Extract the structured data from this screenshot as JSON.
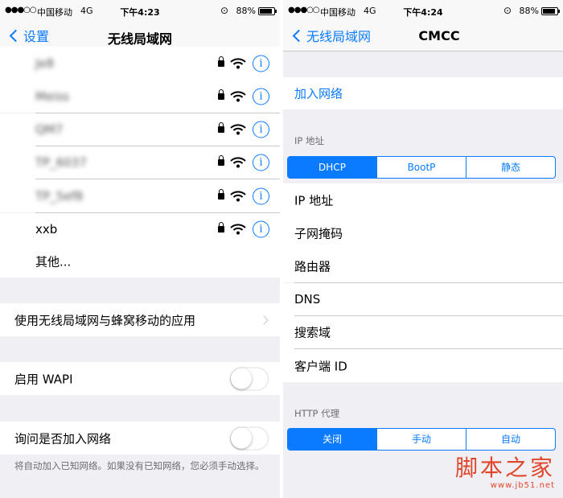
{
  "left": {
    "status": {
      "signal": "●●●○○",
      "carrier": "中国移动",
      "network": "4G",
      "time": "下午4:23",
      "battery_pct": "88%",
      "battery_level": 0.88
    },
    "nav": {
      "back_label": "设置",
      "title": "无线局域网"
    },
    "networks": [
      {
        "name": "Je8",
        "blurred": true
      },
      {
        "name": "Meiss",
        "blurred": true
      },
      {
        "name": "QM7",
        "blurred": true
      },
      {
        "name": "TP_6037",
        "blurred": true
      },
      {
        "name": "TP_5ef8",
        "blurred": true
      },
      {
        "name": "xxb",
        "blurred": false
      }
    ],
    "other_label": "其他...",
    "apps_label": "使用无线局域网与蜂窝移动的应用",
    "wapi_label": "启用 WAPI",
    "ask_join_label": "询问是否加入网络",
    "footer": "将自动加入已知网络。如果没有已知网络，您必须手动选择。"
  },
  "right": {
    "status": {
      "signal": "●●●○○",
      "carrier": "中国移动",
      "network": "4G",
      "time": "下午4:24",
      "battery_pct": "88%",
      "battery_level": 0.88
    },
    "nav": {
      "back_label": "无线局域网",
      "title": "CMCC"
    },
    "join_label": "加入网络",
    "ip_header": "IP 地址",
    "ip_segments": [
      "DHCP",
      "BootP",
      "静态"
    ],
    "ip_selected": 0,
    "rows": [
      "IP 地址",
      "子网掩码",
      "路由器",
      "DNS",
      "搜索域",
      "客户端 ID"
    ],
    "proxy_header": "HTTP 代理",
    "proxy_segments": [
      "关闭",
      "手动",
      "自动"
    ],
    "proxy_selected": 0
  },
  "watermark": {
    "title": "脚本之家",
    "url": "www.jb51.net"
  },
  "colors": {
    "accent": "#0a7aff",
    "background": "#efeff4",
    "separator": "#c8c7cc",
    "watermark": "#e0462a"
  },
  "icons": {
    "lock": "lock-icon",
    "wifi": "wifi-icon",
    "info": "info-icon",
    "back": "chevron-left-icon",
    "disclosure": "chevron-right-icon"
  }
}
